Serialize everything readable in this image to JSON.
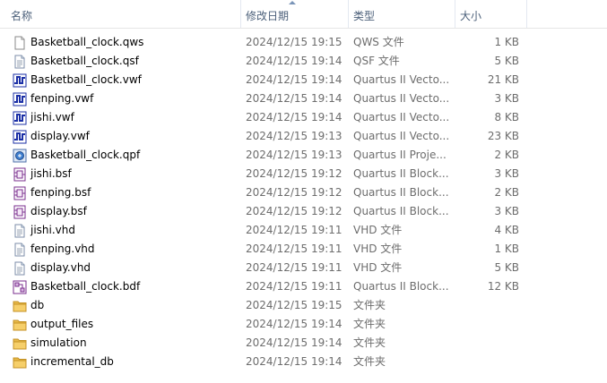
{
  "header": {
    "name": "名称",
    "date": "修改日期",
    "type": "类型",
    "size": "大小"
  },
  "files": [
    {
      "name": "Basketball_clock.qws",
      "date": "2024/12/15 19:15",
      "type": "QWS 文件",
      "size": "1 KB",
      "icon": "blank-file-icon"
    },
    {
      "name": "Basketball_clock.qsf",
      "date": "2024/12/15 19:14",
      "type": "QSF 文件",
      "size": "5 KB",
      "icon": "text-file-icon"
    },
    {
      "name": "Basketball_clock.vwf",
      "date": "2024/12/15 19:14",
      "type": "Quartus II Vecto...",
      "size": "21 KB",
      "icon": "waveform-file-icon"
    },
    {
      "name": "fenping.vwf",
      "date": "2024/12/15 19:14",
      "type": "Quartus II Vecto...",
      "size": "3 KB",
      "icon": "waveform-file-icon"
    },
    {
      "name": "jishi.vwf",
      "date": "2024/12/15 19:14",
      "type": "Quartus II Vecto...",
      "size": "8 KB",
      "icon": "waveform-file-icon"
    },
    {
      "name": "display.vwf",
      "date": "2024/12/15 19:13",
      "type": "Quartus II Vecto...",
      "size": "23 KB",
      "icon": "waveform-file-icon"
    },
    {
      "name": "Basketball_clock.qpf",
      "date": "2024/12/15 19:13",
      "type": "Quartus II Proje...",
      "size": "2 KB",
      "icon": "quartus-project-icon"
    },
    {
      "name": "jishi.bsf",
      "date": "2024/12/15 19:12",
      "type": "Quartus II Block...",
      "size": "3 KB",
      "icon": "block-symbol-icon"
    },
    {
      "name": "fenping.bsf",
      "date": "2024/12/15 19:12",
      "type": "Quartus II Block...",
      "size": "2 KB",
      "icon": "block-symbol-icon"
    },
    {
      "name": "display.bsf",
      "date": "2024/12/15 19:12",
      "type": "Quartus II Block...",
      "size": "3 KB",
      "icon": "block-symbol-icon"
    },
    {
      "name": "jishi.vhd",
      "date": "2024/12/15 19:11",
      "type": "VHD 文件",
      "size": "4 KB",
      "icon": "text-file-icon"
    },
    {
      "name": "fenping.vhd",
      "date": "2024/12/15 19:11",
      "type": "VHD 文件",
      "size": "1 KB",
      "icon": "text-file-icon"
    },
    {
      "name": "display.vhd",
      "date": "2024/12/15 19:11",
      "type": "VHD 文件",
      "size": "5 KB",
      "icon": "text-file-icon"
    },
    {
      "name": "Basketball_clock.bdf",
      "date": "2024/12/15 19:11",
      "type": "Quartus II Block...",
      "size": "12 KB",
      "icon": "block-diagram-icon"
    },
    {
      "name": "db",
      "date": "2024/12/15 19:15",
      "type": "文件夹",
      "size": "",
      "icon": "folder-icon"
    },
    {
      "name": "output_files",
      "date": "2024/12/15 19:14",
      "type": "文件夹",
      "size": "",
      "icon": "folder-icon"
    },
    {
      "name": "simulation",
      "date": "2024/12/15 19:14",
      "type": "文件夹",
      "size": "",
      "icon": "folder-icon"
    },
    {
      "name": "incremental_db",
      "date": "2024/12/15 19:14",
      "type": "文件夹",
      "size": "",
      "icon": "folder-icon"
    }
  ]
}
